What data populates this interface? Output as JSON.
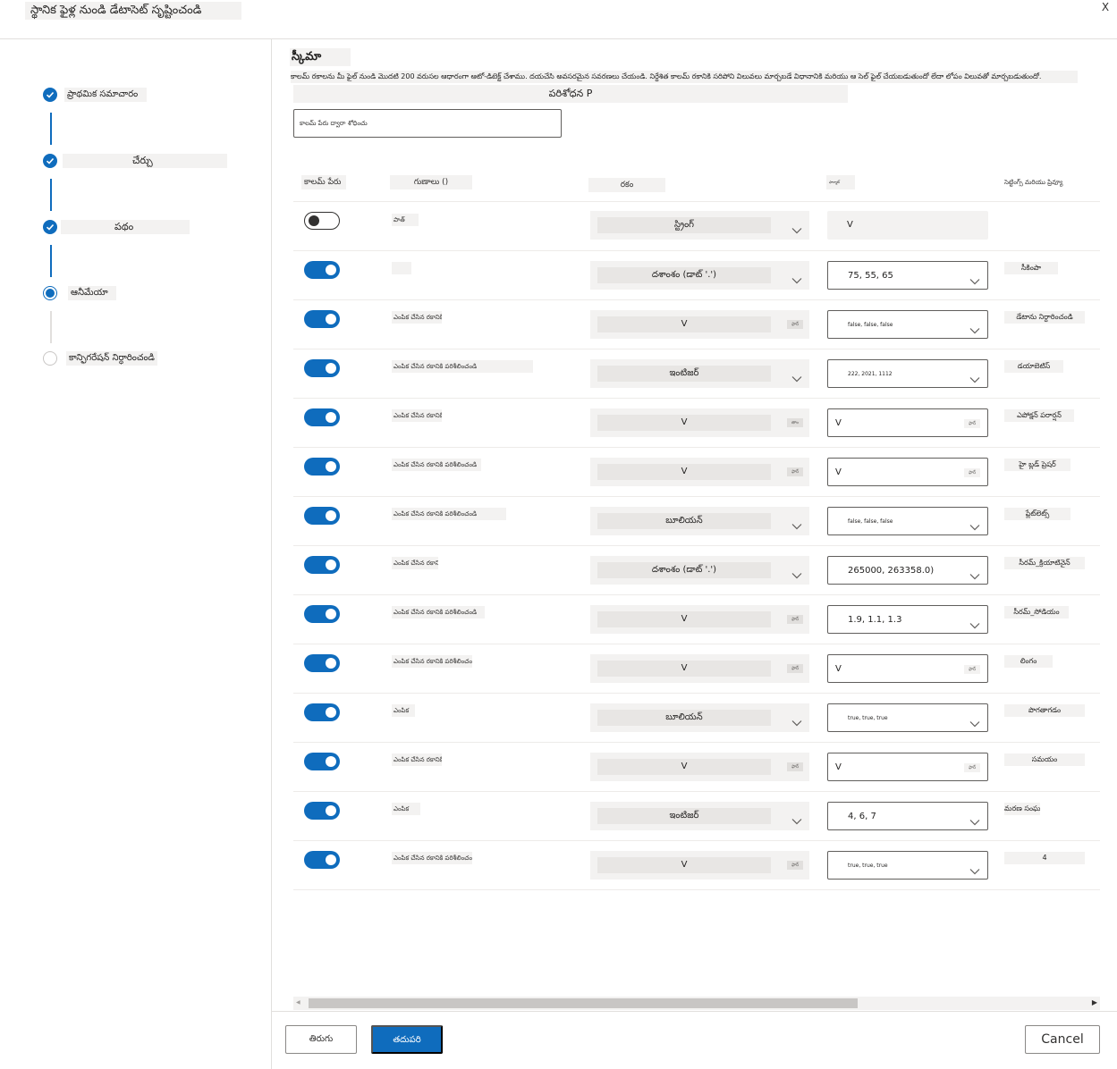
{
  "header": {
    "title": "స్థానిక ఫైళ్ల నుండి డేటాసెట్ సృష్టించండి",
    "close": "X"
  },
  "wizard": {
    "steps": [
      {
        "label": "ప్రాథమిక సమాచారం",
        "state": "done"
      },
      {
        "label": "చేర్చు",
        "state": "done"
      },
      {
        "label": "పథం",
        "state": "done"
      },
      {
        "label": "ఆనీమేయా",
        "state": "current"
      },
      {
        "label": "కాన్ఫిగరేషన్ నిర్ధారించండి",
        "state": "todo"
      }
    ]
  },
  "schema": {
    "title": "స్కీమా",
    "description": "కాలమ్ రకాలను మీ ఫైల్ నుండి మొదటి 200 వరుసల ఆధారంగా ఆటో-డిటెక్ట్ చేశాము. దయచేసి అవసరమైన సవరణలు చేయండి. నిర్దేశిత కాలమ్ రకానికి సరిపోని విలువలు మార్చబడే విధానానికి మరియు ఆ సెల్ ఫైల్ చేయబడుతుందో లేదా లోపం విలువతో మార్చబడుతుందో.",
    "preview_label": "పరిశోధన P",
    "search_placeholder": "కాలమ్ పేరు ద్వారా శోధించు"
  },
  "table": {
    "headers": {
      "include": "కాలమ్ పేరు",
      "properties": "గుణాలు ()",
      "type": "రకం",
      "format": "ఫార్మాట్",
      "settings": "సెట్టింగ్స్ మరియు ప్రివ్యూ"
    },
    "rows": [
      {
        "on": false,
        "prop": "పాత్",
        "type": "స్ట్రింగ్",
        "type_mini": "",
        "format": "V",
        "format_mini": "",
        "format_box": "shade",
        "settings": ""
      },
      {
        "on": true,
        "prop": "",
        "type": "దశాంశం (డాట్ '.')",
        "type_mini": "",
        "format": "75, 55, 65",
        "format_mini": "",
        "format_box": "dd",
        "settings": "సీకింపా"
      },
      {
        "on": true,
        "prop": "ఎంపిక చేసిన రకానికి",
        "type": "V",
        "type_mini": "ఫార్",
        "format": "false, false, false",
        "format_small": true,
        "format_mini": "",
        "format_box": "dd",
        "settings": "డేటాను నిర్దారించండి"
      },
      {
        "on": true,
        "prop": "ఎంపిక చేసిన రకానికి పరిశీలించండి",
        "type": "ఇంటిజర్",
        "type_mini": "",
        "format": "222, 2021, 1112",
        "format_small": true,
        "format_mini": "",
        "format_box": "dd",
        "settings": "డయాబెటిస్"
      },
      {
        "on": true,
        "prop": "ఎంపిక చేసిన రకానికి",
        "type": "V",
        "type_mini": "తాం",
        "format": "V",
        "format_mini": "ఫార్",
        "format_box": "plain",
        "settings": "ఎపోక్షన్ పరార్షన్"
      },
      {
        "on": true,
        "prop": "ఎంపిక చేసిన రకానికి పరిశీలించండి",
        "type": "V",
        "type_mini": "ఫార్",
        "format": "V",
        "format_mini": "ఫార్",
        "format_box": "plain",
        "settings": "హై బ్లడ్ ప్రెషర్"
      },
      {
        "on": true,
        "prop": "ఎంపిక చేసిన రకానికి పరిశీలించండి",
        "type": "బూలియన్",
        "type_mini": "",
        "format": "false, false, false",
        "format_small": true,
        "format_mini": "",
        "format_box": "dd",
        "settings": "ప్లేట్‌లెట్స్"
      },
      {
        "on": true,
        "prop": "ఎంపిక చేసిన రకానికి",
        "type": "దశాంశం (డాట్ '.')",
        "type_mini": "",
        "format": "265000, 263358.0)",
        "format_mini": "",
        "format_box": "dd",
        "settings": "సీరమ్_క్రియాటినైన్"
      },
      {
        "on": true,
        "prop": "ఎంపిక చేసిన రకానికి పరిశీలించండి",
        "type": "V",
        "type_mini": "ఫార్",
        "format": "1.9, 1.1, 1.3",
        "format_mini": "",
        "format_box": "dd",
        "settings": "సీరమ్_సోడియం"
      },
      {
        "on": true,
        "prop": "ఎంపిక చేసిన రకానికి పరిశీలించండి",
        "type": "V",
        "type_mini": "ఫార్",
        "format": "V",
        "format_mini": "ఫార్",
        "format_box": "plain",
        "settings": "లింగం"
      },
      {
        "on": true,
        "prop": "ఎంపిక",
        "type": "బూలియన్",
        "type_mini": "",
        "format": "true, true, true",
        "format_small": true,
        "format_mini": "",
        "format_box": "dd",
        "settings": "పొగతాగడం"
      },
      {
        "on": true,
        "prop": "ఎంపిక చేసిన రకానికి",
        "type": "V",
        "type_mini": "ఫార్",
        "format": "V",
        "format_mini": "ఫార్",
        "format_box": "plain",
        "settings": "సమయం"
      },
      {
        "on": true,
        "prop": "ఎంపిక",
        "type": "ఇంటిజర్",
        "type_mini": "",
        "format": "4, 6, 7",
        "format_mini": "",
        "format_box": "dd",
        "settings": "మరణ సంఘటన"
      },
      {
        "on": true,
        "prop": "ఎంపిక చేసిన రకానికి పరిశీలించండి",
        "type": "V",
        "type_mini": "ఫార్",
        "format": "true, true, true",
        "format_small": true,
        "format_mini": "",
        "format_box": "dd",
        "settings": "4"
      }
    ]
  },
  "footer": {
    "back": "తిరుగు",
    "next": "తదుపరి",
    "cancel": "Cancel"
  },
  "colors": {
    "accent": "#0f6cbd",
    "placeholder_bg": "#f3f2f1"
  }
}
